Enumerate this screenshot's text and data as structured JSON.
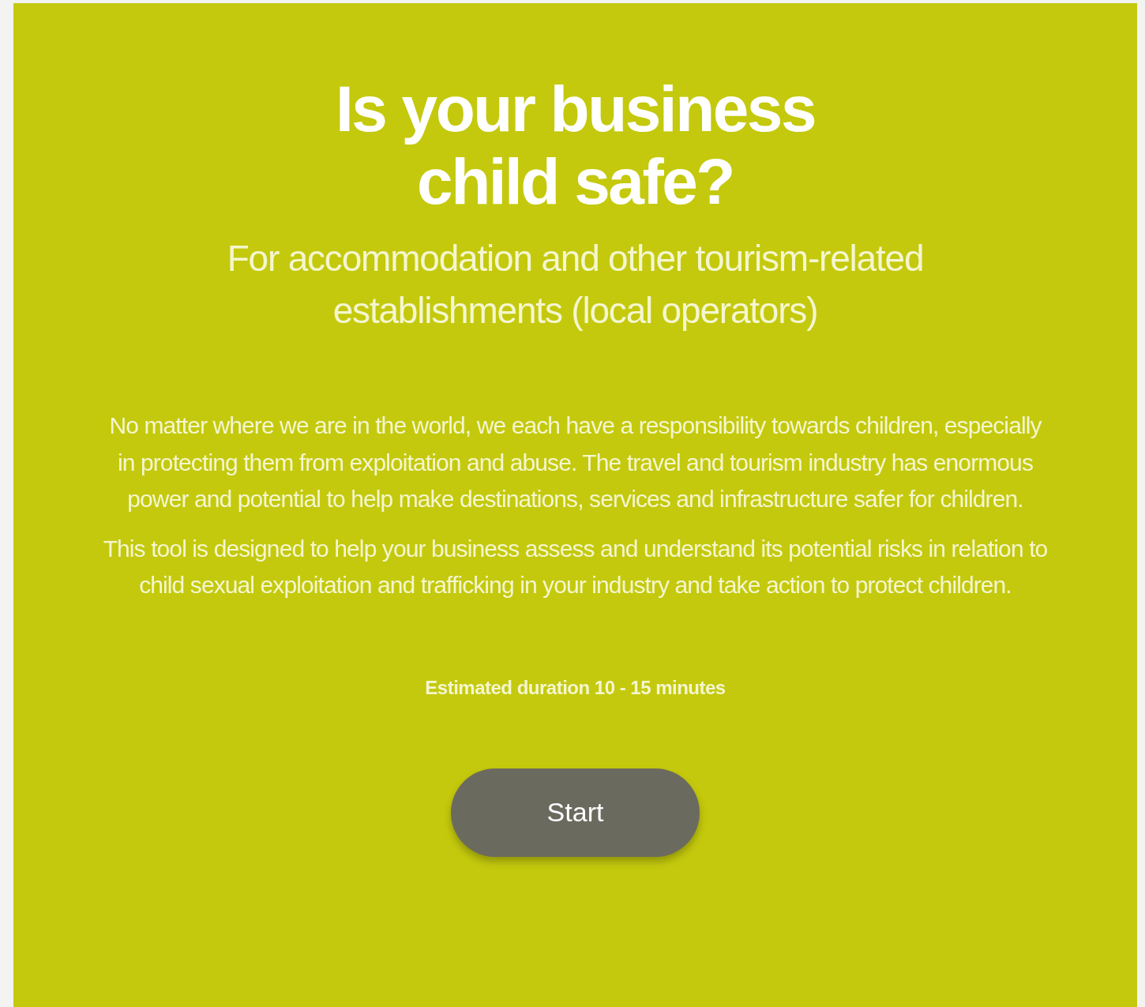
{
  "title": "Is your business child safe?",
  "subtitle": "For accommodation and other tourism-related establishments (local operators)",
  "paragraphs": [
    "No matter where we are in the world, we each have a responsibility towards children, especially in protecting them from exploitation and abuse. The travel and tourism industry has enormous power and potential to help make destinations, services and infrastructure safer for children.",
    "This tool is designed to help your business assess and understand its potential risks in relation to child sexual exploitation and trafficking in your industry and take action to protect children."
  ],
  "duration": "Estimated duration 10 - 15 minutes",
  "start_button": "Start"
}
